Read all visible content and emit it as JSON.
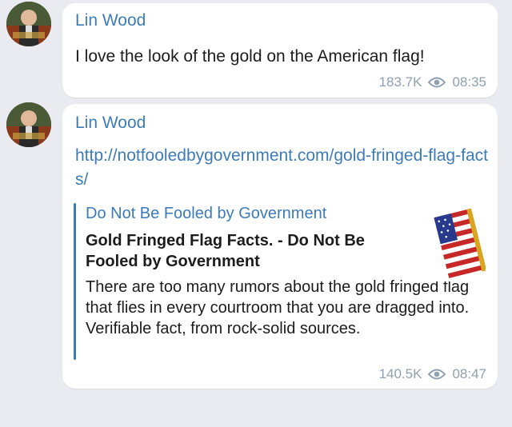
{
  "messages": [
    {
      "sender": "Lin Wood",
      "text": "I love the look of the gold on the American flag!",
      "views": "183.7K",
      "time": "08:35"
    },
    {
      "sender": "Lin Wood",
      "link": "http://notfooledbygovernment.com/gold-fringed-flag-facts/",
      "preview": {
        "site_name": "Do Not Be Fooled by Government",
        "title": "Gold Fringed Flag Facts. - Do Not Be Fooled by Government",
        "description": "There are too many rumors about the gold fringed flag that flies in every courtroom that you are dragged into. Verifiable fact, from rock-solid sources.",
        "thumbnail_icon": "american-flag-icon"
      },
      "views": "140.5K",
      "time": "08:47"
    }
  ],
  "colors": {
    "background": "#e9ebf0",
    "bubble": "#ffffff",
    "accent": "#3d7bb8",
    "meta": "#8fa0b0"
  },
  "icons": {
    "avatar": "profile-photo-avatar",
    "views": "eye-icon"
  }
}
